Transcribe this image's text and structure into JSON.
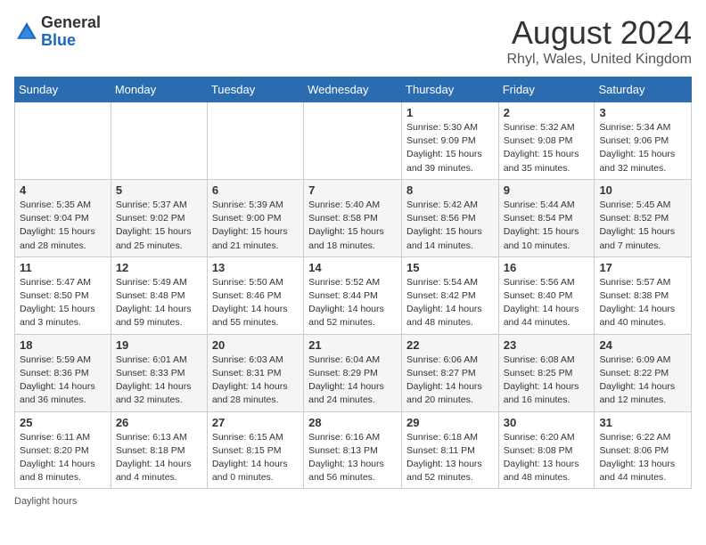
{
  "header": {
    "logo_general": "General",
    "logo_blue": "Blue",
    "month_year": "August 2024",
    "location": "Rhyl, Wales, United Kingdom"
  },
  "days_of_week": [
    "Sunday",
    "Monday",
    "Tuesday",
    "Wednesday",
    "Thursday",
    "Friday",
    "Saturday"
  ],
  "weeks": [
    [
      {
        "day": "",
        "info": ""
      },
      {
        "day": "",
        "info": ""
      },
      {
        "day": "",
        "info": ""
      },
      {
        "day": "",
        "info": ""
      },
      {
        "day": "1",
        "info": "Sunrise: 5:30 AM\nSunset: 9:09 PM\nDaylight: 15 hours\nand 39 minutes."
      },
      {
        "day": "2",
        "info": "Sunrise: 5:32 AM\nSunset: 9:08 PM\nDaylight: 15 hours\nand 35 minutes."
      },
      {
        "day": "3",
        "info": "Sunrise: 5:34 AM\nSunset: 9:06 PM\nDaylight: 15 hours\nand 32 minutes."
      }
    ],
    [
      {
        "day": "4",
        "info": "Sunrise: 5:35 AM\nSunset: 9:04 PM\nDaylight: 15 hours\nand 28 minutes."
      },
      {
        "day": "5",
        "info": "Sunrise: 5:37 AM\nSunset: 9:02 PM\nDaylight: 15 hours\nand 25 minutes."
      },
      {
        "day": "6",
        "info": "Sunrise: 5:39 AM\nSunset: 9:00 PM\nDaylight: 15 hours\nand 21 minutes."
      },
      {
        "day": "7",
        "info": "Sunrise: 5:40 AM\nSunset: 8:58 PM\nDaylight: 15 hours\nand 18 minutes."
      },
      {
        "day": "8",
        "info": "Sunrise: 5:42 AM\nSunset: 8:56 PM\nDaylight: 15 hours\nand 14 minutes."
      },
      {
        "day": "9",
        "info": "Sunrise: 5:44 AM\nSunset: 8:54 PM\nDaylight: 15 hours\nand 10 minutes."
      },
      {
        "day": "10",
        "info": "Sunrise: 5:45 AM\nSunset: 8:52 PM\nDaylight: 15 hours\nand 7 minutes."
      }
    ],
    [
      {
        "day": "11",
        "info": "Sunrise: 5:47 AM\nSunset: 8:50 PM\nDaylight: 15 hours\nand 3 minutes."
      },
      {
        "day": "12",
        "info": "Sunrise: 5:49 AM\nSunset: 8:48 PM\nDaylight: 14 hours\nand 59 minutes."
      },
      {
        "day": "13",
        "info": "Sunrise: 5:50 AM\nSunset: 8:46 PM\nDaylight: 14 hours\nand 55 minutes."
      },
      {
        "day": "14",
        "info": "Sunrise: 5:52 AM\nSunset: 8:44 PM\nDaylight: 14 hours\nand 52 minutes."
      },
      {
        "day": "15",
        "info": "Sunrise: 5:54 AM\nSunset: 8:42 PM\nDaylight: 14 hours\nand 48 minutes."
      },
      {
        "day": "16",
        "info": "Sunrise: 5:56 AM\nSunset: 8:40 PM\nDaylight: 14 hours\nand 44 minutes."
      },
      {
        "day": "17",
        "info": "Sunrise: 5:57 AM\nSunset: 8:38 PM\nDaylight: 14 hours\nand 40 minutes."
      }
    ],
    [
      {
        "day": "18",
        "info": "Sunrise: 5:59 AM\nSunset: 8:36 PM\nDaylight: 14 hours\nand 36 minutes."
      },
      {
        "day": "19",
        "info": "Sunrise: 6:01 AM\nSunset: 8:33 PM\nDaylight: 14 hours\nand 32 minutes."
      },
      {
        "day": "20",
        "info": "Sunrise: 6:03 AM\nSunset: 8:31 PM\nDaylight: 14 hours\nand 28 minutes."
      },
      {
        "day": "21",
        "info": "Sunrise: 6:04 AM\nSunset: 8:29 PM\nDaylight: 14 hours\nand 24 minutes."
      },
      {
        "day": "22",
        "info": "Sunrise: 6:06 AM\nSunset: 8:27 PM\nDaylight: 14 hours\nand 20 minutes."
      },
      {
        "day": "23",
        "info": "Sunrise: 6:08 AM\nSunset: 8:25 PM\nDaylight: 14 hours\nand 16 minutes."
      },
      {
        "day": "24",
        "info": "Sunrise: 6:09 AM\nSunset: 8:22 PM\nDaylight: 14 hours\nand 12 minutes."
      }
    ],
    [
      {
        "day": "25",
        "info": "Sunrise: 6:11 AM\nSunset: 8:20 PM\nDaylight: 14 hours\nand 8 minutes."
      },
      {
        "day": "26",
        "info": "Sunrise: 6:13 AM\nSunset: 8:18 PM\nDaylight: 14 hours\nand 4 minutes."
      },
      {
        "day": "27",
        "info": "Sunrise: 6:15 AM\nSunset: 8:15 PM\nDaylight: 14 hours\nand 0 minutes."
      },
      {
        "day": "28",
        "info": "Sunrise: 6:16 AM\nSunset: 8:13 PM\nDaylight: 13 hours\nand 56 minutes."
      },
      {
        "day": "29",
        "info": "Sunrise: 6:18 AM\nSunset: 8:11 PM\nDaylight: 13 hours\nand 52 minutes."
      },
      {
        "day": "30",
        "info": "Sunrise: 6:20 AM\nSunset: 8:08 PM\nDaylight: 13 hours\nand 48 minutes."
      },
      {
        "day": "31",
        "info": "Sunrise: 6:22 AM\nSunset: 8:06 PM\nDaylight: 13 hours\nand 44 minutes."
      }
    ]
  ],
  "footer": {
    "label": "Daylight hours"
  }
}
